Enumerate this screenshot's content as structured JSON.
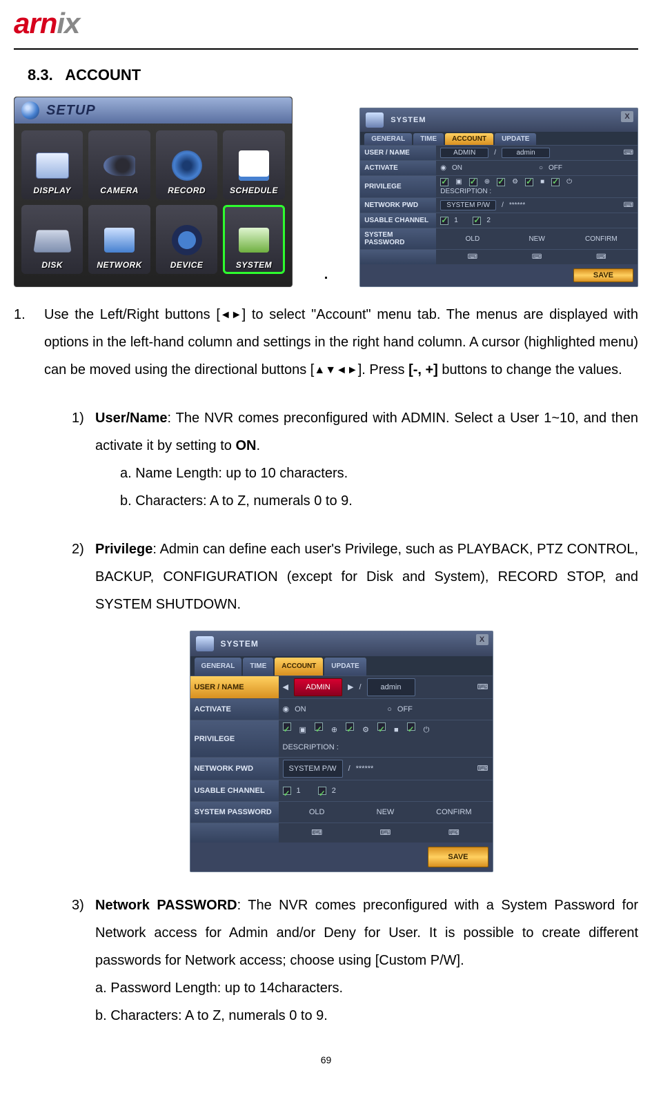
{
  "logo": {
    "part1": "arn",
    "part2": "ix"
  },
  "section": {
    "num": "8.3.",
    "title": "ACCOUNT"
  },
  "setup": {
    "title": "SETUP",
    "items": [
      {
        "label": "DISPLAY"
      },
      {
        "label": "CAMERA"
      },
      {
        "label": "RECORD"
      },
      {
        "label": "SCHEDULE"
      },
      {
        "label": "DISK"
      },
      {
        "label": "NETWORK"
      },
      {
        "label": "DEVICE"
      },
      {
        "label": "SYSTEM"
      }
    ]
  },
  "syswin": {
    "title": "SYSTEM",
    "close": "X",
    "tabs": {
      "general": "GENERAL",
      "time": "TIME",
      "account": "ACCOUNT",
      "update": "UPDATE"
    },
    "rows": {
      "user": {
        "label": "USER / NAME",
        "val": "ADMIN",
        "name": "admin"
      },
      "activate": {
        "label": "ACTIVATE",
        "on": "ON",
        "off": "OFF"
      },
      "privilege": {
        "label": "PRIVILEGE",
        "desc": "DESCRIPTION :"
      },
      "network_pwd": {
        "label": "NETWORK PWD",
        "val": "SYSTEM P/W",
        "mask": "******"
      },
      "usable": {
        "label": "USABLE CHANNEL"
      },
      "syspass": {
        "label": "SYSTEM PASSWORD",
        "old": "OLD",
        "new": "NEW",
        "confirm": "CONFIRM"
      }
    },
    "save": "SAVE"
  },
  "text": {
    "para1a": "Use the Left/Right buttons [",
    "para1b": "] to select \"Account\" menu tab. The menus are displayed with options in the left-hand column and settings in the right hand column. A cursor (highlighted menu) can be moved using the directional buttons [",
    "para1c": "]. Press ",
    "para1d": "[-, +]",
    "para1e": " buttons to change the values.",
    "arrow_lr": "◄►",
    "arrow_all": "▲▼◄►",
    "i1_num": "1.",
    "s1_num": "1)",
    "s1_label": "User/Name",
    "s1_body": ":   The NVR comes preconfigured with ADMIN. Select a User 1~10, and then activate it by setting to ",
    "s1_on": "ON",
    "s1_dot": ".",
    "s1_a": "a. Name Length: up to 10 characters.",
    "s1_b": "b. Characters: A to Z, numerals 0 to 9.",
    "s2_num": "2)",
    "s2_label": "Privilege",
    "s2_body": ": Admin can define each user's Privilege, such as PLAYBACK, PTZ CONTROL, BACKUP, CONFIGURATION (except for Disk and System), RECORD STOP, and SYSTEM SHUTDOWN.",
    "s3_num": "3)",
    "s3_label": "Network PASSWORD",
    "s3_body": ": The NVR comes preconfigured with a System Password for Network access for Admin and/or Deny for User. It is possible to create different passwords for Network access; choose using [Custom P/W].",
    "s3_a": "a. Password Length: up to 14characters.",
    "s3_b": "b. Characters: A to Z, numerals 0 to 9."
  },
  "syswinB": {
    "rows": {
      "user": {
        "val": "ADMIN",
        "name": "admin"
      }
    }
  },
  "page_number": "69"
}
